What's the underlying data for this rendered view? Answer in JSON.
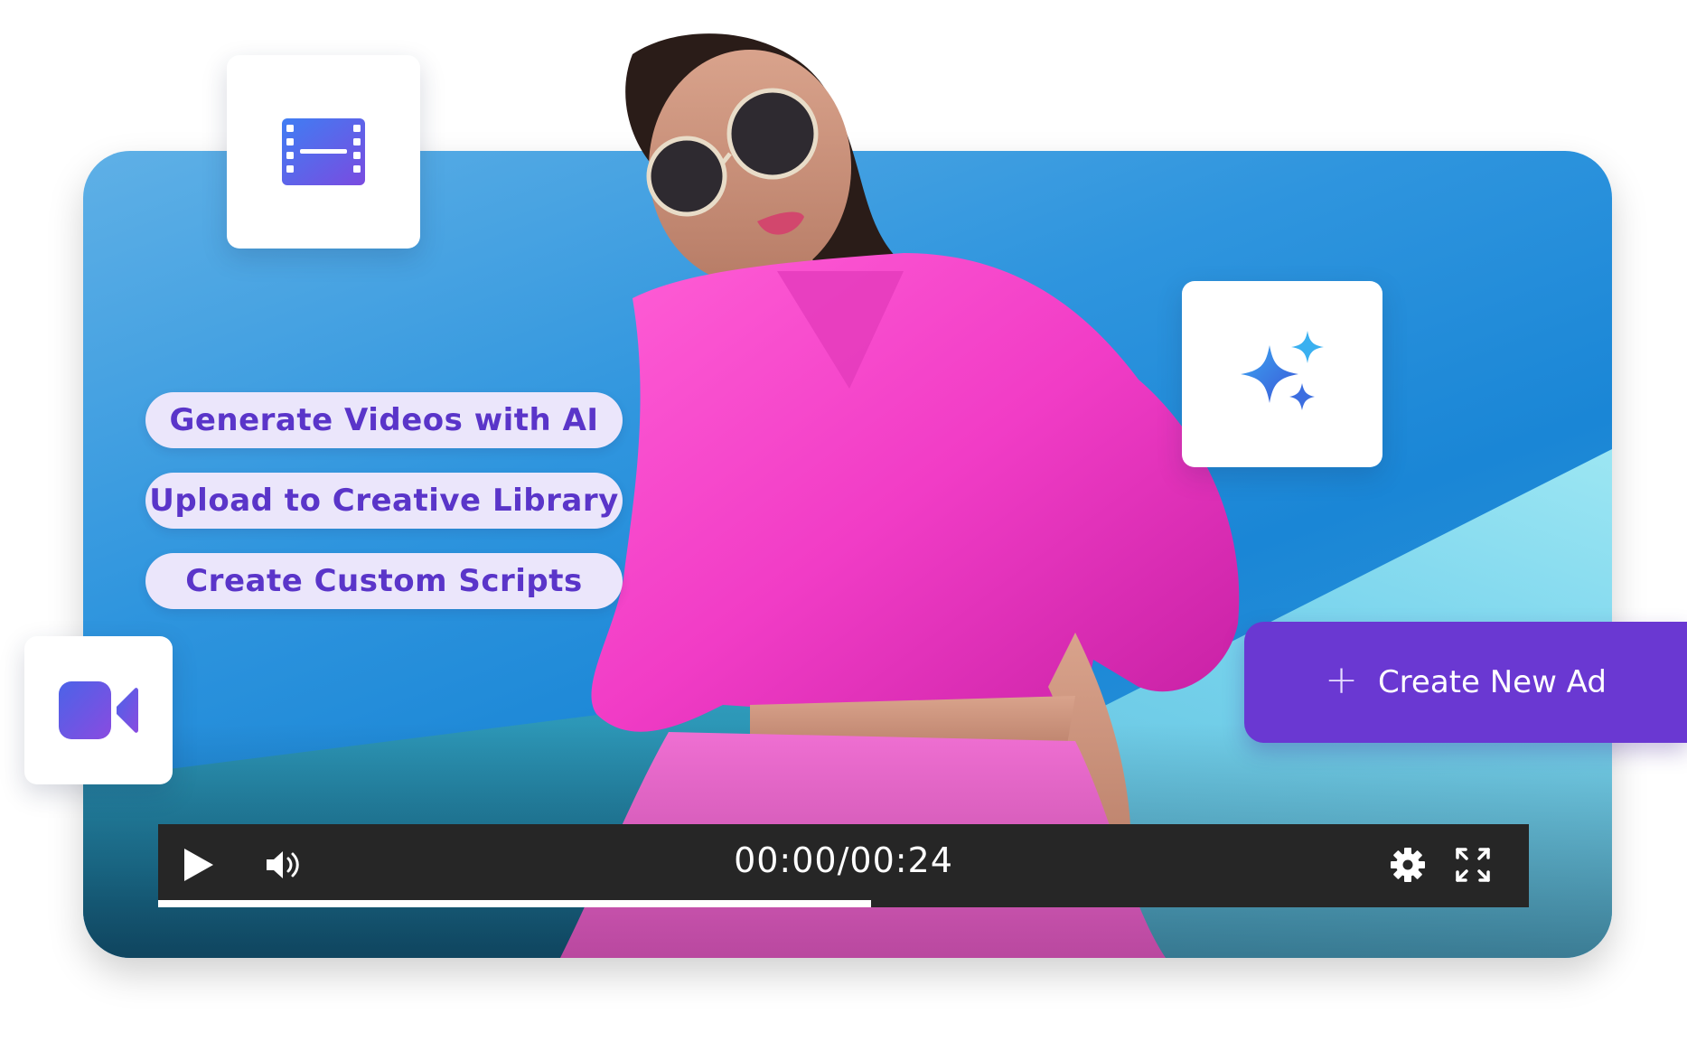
{
  "features": [
    {
      "label": "Generate Videos with AI"
    },
    {
      "label": "Upload to Creative Library"
    },
    {
      "label": "Create Custom Scripts"
    }
  ],
  "cta": {
    "label": "Create New Ad",
    "icon": "plus-icon"
  },
  "player": {
    "time": "00:00/00:24",
    "progress": 0.52,
    "icons": [
      "play-icon",
      "volume-icon",
      "settings-icon",
      "fullscreen-icon"
    ]
  },
  "tiles": [
    "film-strip-icon",
    "sparkles-icon",
    "video-camera-icon"
  ],
  "colors": {
    "accent": "#6a38d2",
    "pill_bg": "#ebe6fb",
    "pill_text": "#5a35c9",
    "player_bg": "#262626"
  }
}
